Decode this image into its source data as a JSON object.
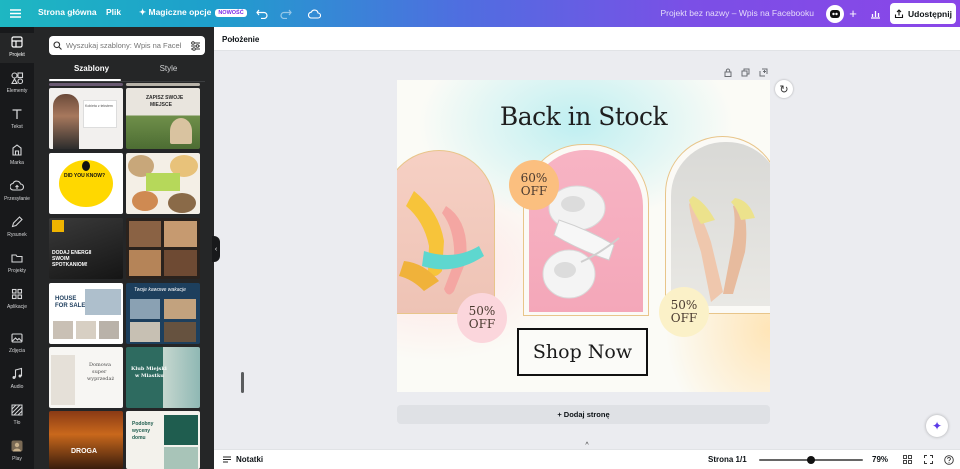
{
  "topbar": {
    "home": "Strona główna",
    "file": "Plik",
    "magic": "Magiczne opcje",
    "magic_badge": "NOWOŚĆ",
    "doc_title": "Projekt bez nazwy – Wpis na Facebooku",
    "share": "Udostępnij"
  },
  "rail": [
    {
      "label": "Projekt",
      "icon": "layout-icon"
    },
    {
      "label": "Elementy",
      "icon": "shapes-icon"
    },
    {
      "label": "Tekst",
      "icon": "text-icon"
    },
    {
      "label": "Marka",
      "icon": "brand-icon"
    },
    {
      "label": "Przesyłanie",
      "icon": "upload-icon"
    },
    {
      "label": "Rysunek",
      "icon": "draw-icon"
    },
    {
      "label": "Projekty",
      "icon": "folder-icon"
    },
    {
      "label": "Aplikacje",
      "icon": "apps-icon"
    },
    {
      "label": "Zdjęcia",
      "icon": "photos-icon"
    },
    {
      "label": "Audio",
      "icon": "music-icon"
    },
    {
      "label": "Tło",
      "icon": "background-icon"
    },
    {
      "label": "Play",
      "icon": "avatar-icon"
    }
  ],
  "panel": {
    "search_placeholder": "Wyszukaj szablony: Wpis na Facebo",
    "tabs": [
      "Szablony",
      "Style"
    ]
  },
  "templates": {
    "t1_text": "Kobieta z tekstem",
    "t2_line1": "ZAPISZ SWOJE",
    "t2_line2": "MIEJSCE",
    "t3_line1": "DID YOU KNOW?",
    "t4_text": "",
    "t5_line1": "DODAJ ENERGII",
    "t5_line2": "SWOIM",
    "t5_line3": "SPOTKANIOM!",
    "t7_line1": "HOUSE",
    "t7_line2": "FOR SALE",
    "t8_text": "Twoje kawowe wakacje",
    "t9_line1": "Domowa",
    "t9_line2": "super",
    "t9_line3": "wyprzedaż",
    "t10_line1": "Klub Miejski",
    "t10_line2": "w Miastku",
    "t11_line1": "DROGA",
    "t12_line1": "Podobny",
    "t12_line2": "wyceny",
    "t12_line3": "domu"
  },
  "context_bar": {
    "position": "Położenie"
  },
  "canvas": {
    "title": "Back in Stock",
    "badge_60": [
      "60%",
      "OFF"
    ],
    "badge_50_left": [
      "50%",
      "OFF"
    ],
    "badge_50_right": [
      "50%",
      "OFF"
    ],
    "cta": "Shop Now"
  },
  "add_page": "+ Dodaj stronę",
  "bottombar": {
    "notes": "Notatki",
    "page": "Strona 1/1",
    "zoom": "79%",
    "zoom_level": 0.5
  },
  "colors": {
    "brand_gradient_start": "#1eb7c2",
    "brand_gradient_end": "#8a46e8",
    "sidebar_bg": "#18191b",
    "panel_bg": "#252627"
  }
}
